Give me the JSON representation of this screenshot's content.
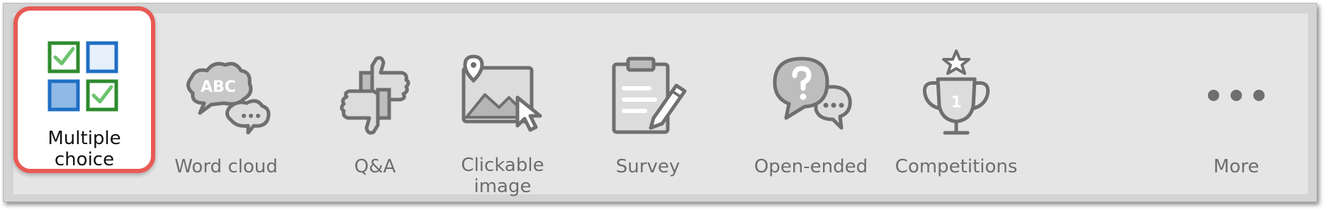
{
  "colors": {
    "accent_border": "#e85a55",
    "icon_gray": "#6f6f6f",
    "icon_fill": "#dcdcdc",
    "check_green": "#3a9c3a",
    "box_blue": "#1f6fc4"
  },
  "toolbar": {
    "items": [
      {
        "label": "Multiple choice",
        "icon": "multiple-choice-icon",
        "selected": true
      },
      {
        "label": "Word cloud",
        "icon": "word-cloud-icon"
      },
      {
        "label": "Q&A",
        "icon": "thumbs-up-down-icon"
      },
      {
        "label": "Clickable image",
        "icon": "clickable-image-icon"
      },
      {
        "label": "Survey",
        "icon": "clipboard-pencil-icon"
      },
      {
        "label": "Open-ended",
        "icon": "question-bubbles-icon"
      },
      {
        "label": "Competitions",
        "icon": "trophy-icon"
      },
      {
        "label": "More",
        "icon": "more-dots-icon"
      }
    ],
    "word_cloud_icon_text": "ABC",
    "trophy_icon_text": "1"
  }
}
